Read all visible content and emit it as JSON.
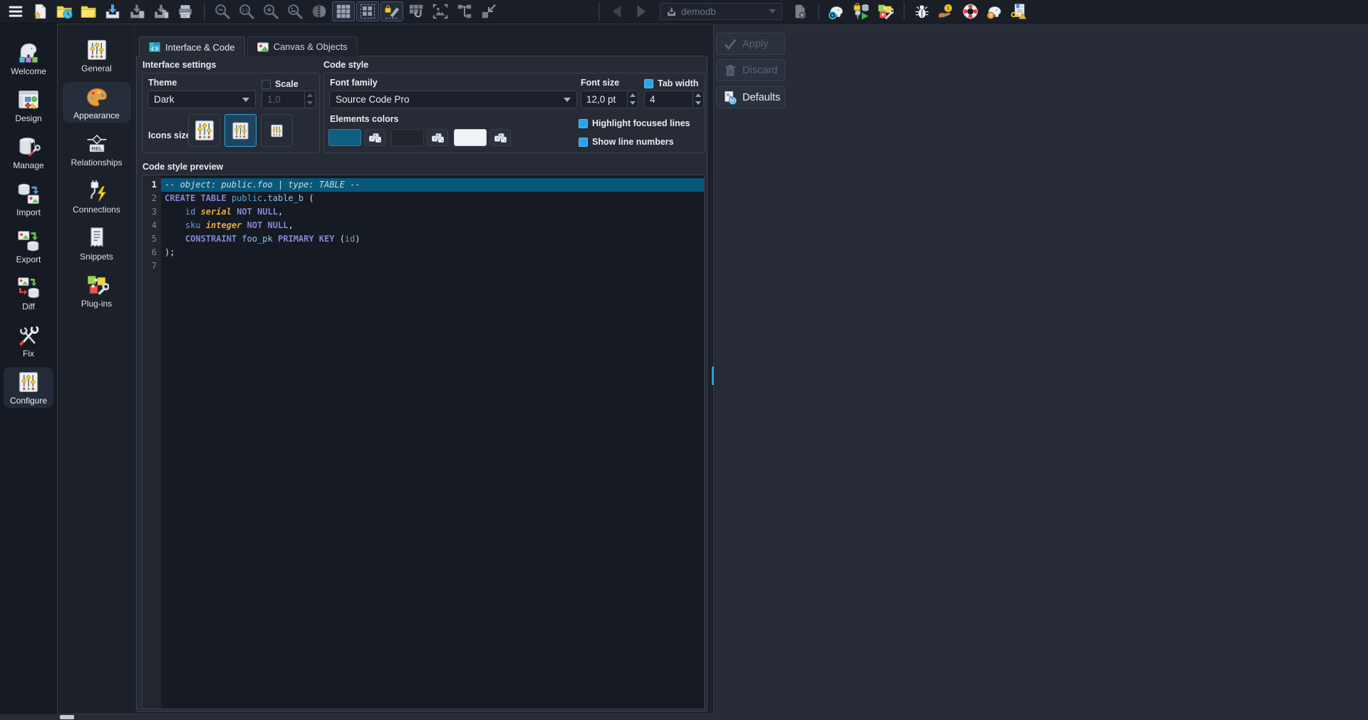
{
  "colors": {
    "accent_blue": "#2aa3e8",
    "selected_code_line": "#07587a",
    "toolbar_bg": "#1a1e27",
    "panel_bg": "#262b35"
  },
  "toolbar": {
    "model_selector": {
      "value": "demodb",
      "state": "disabled"
    },
    "items": [
      {
        "name": "main-menu",
        "icon": "menu",
        "state": "enabled"
      },
      {
        "name": "new-model",
        "icon": "new-model",
        "state": "enabled"
      },
      {
        "name": "recent-models",
        "icon": "open-recent",
        "state": "enabled"
      },
      {
        "name": "open-model",
        "icon": "open-folder",
        "state": "enabled"
      },
      {
        "name": "save-model",
        "icon": "save",
        "state": "enabled"
      },
      {
        "name": "save-model-as",
        "icon": "save-as",
        "state": "disabled"
      },
      {
        "name": "save-all",
        "icon": "save-all",
        "state": "disabled"
      },
      {
        "name": "print-model",
        "icon": "print",
        "state": "disabled"
      },
      {
        "type": "separator"
      },
      {
        "name": "zoom-out",
        "icon": "zoom-out",
        "state": "disabled"
      },
      {
        "name": "zoom-original",
        "icon": "zoom-original",
        "state": "disabled"
      },
      {
        "name": "zoom-in",
        "icon": "zoom-in",
        "state": "disabled"
      },
      {
        "name": "fit-view",
        "icon": "magnifier-picture",
        "state": "disabled"
      },
      {
        "name": "center-view",
        "icon": "mirror",
        "state": "disabled"
      },
      {
        "name": "show-grid",
        "icon": "grid",
        "state": "toggled"
      },
      {
        "name": "align-to-grid",
        "icon": "grid-dashed",
        "state": "toggled"
      },
      {
        "name": "lock-delimiters",
        "icon": "pencil-lock",
        "state": "toggled"
      },
      {
        "name": "snap-to-grid",
        "icon": "grid-hook",
        "state": "disabled"
      },
      {
        "name": "preview-image",
        "icon": "picture-frame",
        "state": "disabled"
      },
      {
        "name": "arrange-objects",
        "icon": "tree-links",
        "state": "disabled"
      },
      {
        "name": "compact-view",
        "icon": "shrink",
        "state": "disabled"
      },
      {
        "type": "spacer"
      },
      {
        "type": "separator"
      },
      {
        "name": "undo",
        "icon": "arrow-left",
        "state": "disabled"
      },
      {
        "name": "redo",
        "icon": "arrow-right",
        "state": "disabled"
      },
      {
        "type": "model-combo"
      },
      {
        "name": "close-model",
        "icon": "file-close",
        "state": "disabled"
      },
      {
        "type": "separator"
      },
      {
        "name": "source-code",
        "icon": "elephant-sql",
        "state": "enabled"
      },
      {
        "name": "model-validation",
        "icon": "plug-validate",
        "state": "enabled"
      },
      {
        "name": "plugins-toolbar",
        "icon": "puzzle-wrench",
        "state": "enabled"
      },
      {
        "type": "separator"
      },
      {
        "name": "report-bug",
        "icon": "bug",
        "state": "enabled"
      },
      {
        "name": "donate",
        "icon": "donate",
        "state": "enabled"
      },
      {
        "name": "support",
        "icon": "lifebuoy",
        "state": "enabled"
      },
      {
        "name": "about",
        "icon": "elephant-help",
        "state": "enabled"
      },
      {
        "name": "license",
        "icon": "license-key",
        "state": "enabled"
      }
    ]
  },
  "left_sidebar": {
    "selected": "Configure",
    "items": [
      {
        "label": "Welcome",
        "icon": "welcome"
      },
      {
        "label": "Design",
        "icon": "design"
      },
      {
        "label": "Manage",
        "icon": "manage"
      },
      {
        "label": "Import",
        "icon": "import"
      },
      {
        "label": "Export",
        "icon": "export"
      },
      {
        "label": "Diff",
        "icon": "diff"
      },
      {
        "label": "Fix",
        "icon": "fix"
      },
      {
        "label": "Configure",
        "icon": "sliders"
      }
    ]
  },
  "config_sidebar": {
    "selected": "Appearance",
    "items": [
      {
        "label": "General",
        "icon": "sliders"
      },
      {
        "label": "Appearance",
        "icon": "appearance"
      },
      {
        "label": "Relationships",
        "icon": "relationships"
      },
      {
        "label": "Connections",
        "icon": "connections"
      },
      {
        "label": "Snippets",
        "icon": "snippets"
      },
      {
        "label": "Plug-ins",
        "icon": "plugins"
      }
    ]
  },
  "tabs": [
    {
      "label": "Interface & Code",
      "icon": "interface-tab",
      "active": true
    },
    {
      "label": "Canvas & Objects",
      "icon": "canvas-tab",
      "active": false
    }
  ],
  "interface_settings": {
    "title": "Interface settings",
    "theme_label": "Theme",
    "theme_value": "Dark",
    "scale_label": "Scale",
    "scale_checked": false,
    "scale_value": "1,0",
    "icons_size_label": "Icons size",
    "icons_size_selected": 1
  },
  "code_style": {
    "title": "Code style",
    "font_family_label": "Font family",
    "font_family_value": "Source Code Pro",
    "font_size_label": "Font size",
    "font_size_value": "12,0 pt",
    "tab_width_label": "Tab width",
    "tab_width_checked": true,
    "tab_width_value": "4",
    "elements_colors_label": "Elements colors",
    "swatches": [
      "#0e5f80",
      "#21262d",
      "#f1f2f3"
    ],
    "highlight_label": "Highlight focused lines",
    "highlight_checked": true,
    "line_numbers_label": "Show line numbers",
    "line_numbers_checked": true
  },
  "code_preview": {
    "title": "Code style preview",
    "token_colors": {
      "comment": "#d5dae0",
      "keyword": "#8186d8",
      "ident": "#5f9fd9",
      "name": "#8ec2ea",
      "type": "#eaa73e",
      "plain": "#dcdfe3"
    },
    "lines": [
      {
        "num": "1",
        "highlight": true,
        "tokens": [
          {
            "t": "-- object: public.foo | type: TABLE --",
            "c": "comment"
          }
        ]
      },
      {
        "num": "2",
        "highlight": false,
        "tokens": [
          {
            "t": "CREATE TABLE",
            "c": "keyword"
          },
          {
            "t": " ",
            "c": "plain"
          },
          {
            "t": "public",
            "c": "ident"
          },
          {
            "t": ".",
            "c": "plain"
          },
          {
            "t": "table_b",
            "c": "name"
          },
          {
            "t": " (",
            "c": "plain"
          }
        ]
      },
      {
        "num": "3",
        "highlight": false,
        "tokens": [
          {
            "t": "    ",
            "c": "plain"
          },
          {
            "t": "id",
            "c": "ident"
          },
          {
            "t": " ",
            "c": "plain"
          },
          {
            "t": "serial",
            "c": "type"
          },
          {
            "t": " ",
            "c": "plain"
          },
          {
            "t": "NOT NULL",
            "c": "keyword"
          },
          {
            "t": ",",
            "c": "plain"
          }
        ]
      },
      {
        "num": "4",
        "highlight": false,
        "tokens": [
          {
            "t": "    ",
            "c": "plain"
          },
          {
            "t": "sku",
            "c": "ident"
          },
          {
            "t": " ",
            "c": "plain"
          },
          {
            "t": "integer",
            "c": "type"
          },
          {
            "t": " ",
            "c": "plain"
          },
          {
            "t": "NOT NULL",
            "c": "keyword"
          },
          {
            "t": ",",
            "c": "plain"
          }
        ]
      },
      {
        "num": "5",
        "highlight": false,
        "tokens": [
          {
            "t": "    ",
            "c": "plain"
          },
          {
            "t": "CONSTRAINT",
            "c": "keyword"
          },
          {
            "t": " ",
            "c": "plain"
          },
          {
            "t": "foo_pk",
            "c": "name"
          },
          {
            "t": " ",
            "c": "plain"
          },
          {
            "t": "PRIMARY KEY",
            "c": "keyword"
          },
          {
            "t": " (",
            "c": "plain"
          },
          {
            "t": "id",
            "c": "ident"
          },
          {
            "t": ")",
            "c": "plain"
          }
        ]
      },
      {
        "num": "6",
        "highlight": false,
        "tokens": [
          {
            "t": ");",
            "c": "plain"
          }
        ]
      },
      {
        "num": "7",
        "highlight": false,
        "tokens": []
      }
    ]
  },
  "actions": [
    {
      "label": "Apply",
      "icon": "check",
      "enabled": false
    },
    {
      "label": "Discard",
      "icon": "trash",
      "enabled": false
    },
    {
      "label": "Defaults",
      "icon": "defaults",
      "enabled": true
    }
  ]
}
